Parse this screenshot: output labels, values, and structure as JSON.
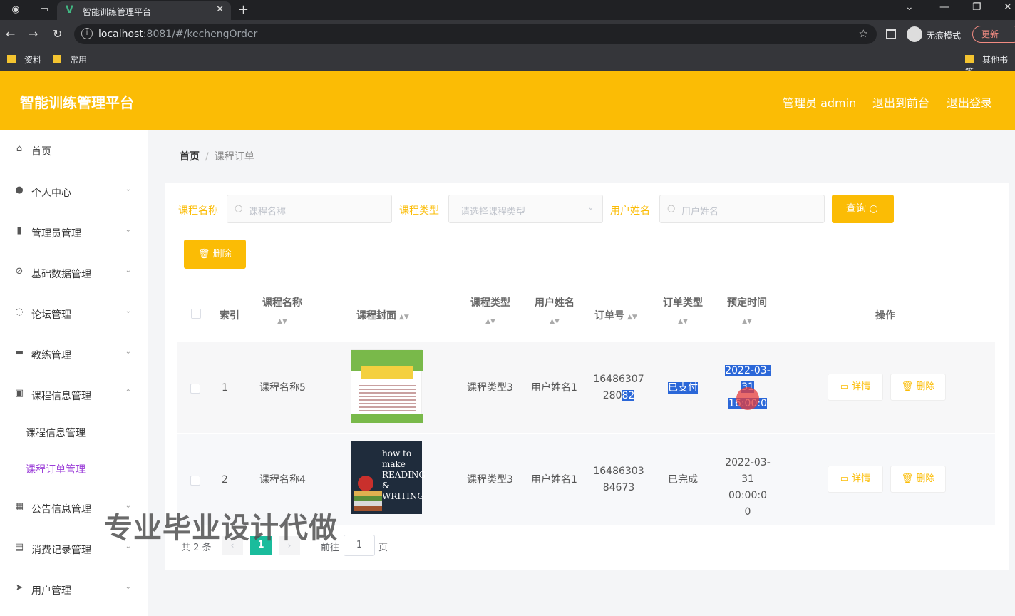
{
  "browser": {
    "tab_title": "智能训练管理平台",
    "url_host": "localhost",
    "url_rest": ":8081/#/kechengOrder",
    "incognito_label": "无痕模式",
    "update_label": "更新",
    "bookmarks": [
      "资料",
      "常用",
      "其他书签"
    ]
  },
  "header": {
    "title": "智能训练管理平台",
    "admin_label": "管理员 admin",
    "to_front_label": "退出到前台",
    "logout_label": "退出登录"
  },
  "sidebar": {
    "items": [
      {
        "label": "首页",
        "icon": "home-icon"
      },
      {
        "label": "个人中心",
        "icon": "user-icon"
      },
      {
        "label": "管理员管理",
        "icon": "admin-icon"
      },
      {
        "label": "基础数据管理",
        "icon": "data-icon"
      },
      {
        "label": "论坛管理",
        "icon": "forum-icon"
      },
      {
        "label": "教练管理",
        "icon": "coach-icon"
      },
      {
        "label": "课程信息管理",
        "icon": "course-icon"
      },
      {
        "label": "公告信息管理",
        "icon": "notice-icon"
      },
      {
        "label": "消费记录管理",
        "icon": "record-icon"
      },
      {
        "label": "用户管理",
        "icon": "send-icon"
      }
    ],
    "submenu": [
      "课程信息管理",
      "课程订单管理"
    ]
  },
  "breadcrumb": {
    "home": "首页",
    "current": "课程订单"
  },
  "filters": {
    "course_name_label": "课程名称",
    "course_name_placeholder": "课程名称",
    "course_type_label": "课程类型",
    "course_type_placeholder": "请选择课程类型",
    "user_name_label": "用户姓名",
    "user_name_placeholder": "用户姓名",
    "query_label": "查询",
    "delete_label": "删除"
  },
  "table": {
    "headers": {
      "index": "索引",
      "course_name": "课程名称",
      "cover": "课程封面",
      "course_type": "课程类型",
      "user_name": "用户姓名",
      "order_no": "订单号",
      "order_type": "订单类型",
      "reserve_time": "预定时间",
      "actions": "操作"
    },
    "rows": [
      {
        "index": "1",
        "course_name": "课程名称5",
        "course_type": "课程类型3",
        "user_name": "用户姓名1",
        "order_no_1": "16486307",
        "order_no_2a": "280",
        "order_no_2b": "82",
        "order_type": "已支付",
        "time_1": "2022-03-",
        "time_2": "31 16:00:0",
        "cover_text": ""
      },
      {
        "index": "2",
        "course_name": "课程名称4",
        "course_type": "课程类型3",
        "user_name": "用户姓名1",
        "order_no_1": "16486303",
        "order_no_2": "84673",
        "order_type": "已完成",
        "time_1": "2022-03-",
        "time_2": "31 00:00:0",
        "time_3": "0",
        "cover_text": "how to make READING & WRITING"
      }
    ],
    "detail_label": "详情",
    "delete_label": "删除"
  },
  "pagination": {
    "total": "共 2 条",
    "current_page": "1",
    "goto_label": "前往",
    "goto_value": "1",
    "page_suffix": "页"
  },
  "watermark": "专业毕业设计代做",
  "colors": {
    "accent": "#fbbc05",
    "page_active": "#1abc9c",
    "menu_active": "#9b3dd8"
  }
}
